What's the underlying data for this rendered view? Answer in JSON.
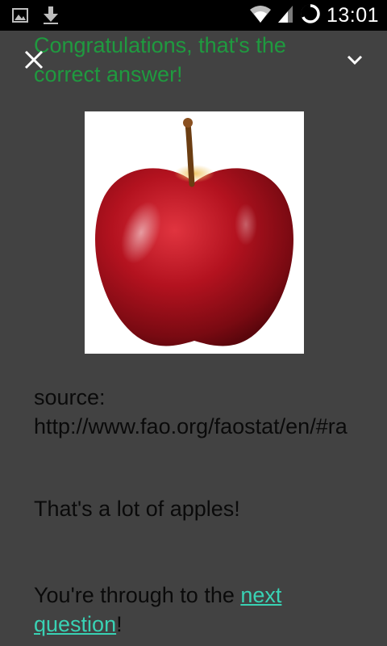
{
  "status_bar": {
    "time": "13:01",
    "icons": [
      "image-icon",
      "download-icon",
      "wifi-icon",
      "signal-icon",
      "sync-icon"
    ]
  },
  "header": {
    "title": "Congratulations, that's the correct answer!",
    "title_color": "#1f9a3f"
  },
  "body": {
    "source_label": "source:",
    "source_url": "http://www.fao.org/faostat/en/#ra",
    "lots_text": "That's a lot of apples!",
    "through_prefix": "You're through to the ",
    "next_link": "next question",
    "through_suffix": "!",
    "link_color": "#39d2b4"
  },
  "colors": {
    "background": "#424242",
    "status_bar": "#000000",
    "apple_red": "#b3121f"
  }
}
